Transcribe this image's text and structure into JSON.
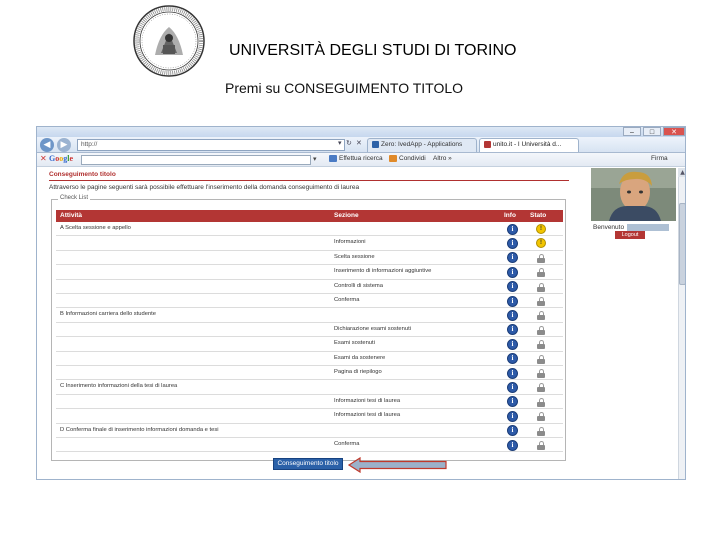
{
  "slide": {
    "title": "UNIVERSITÀ DEGLI STUDI DI TORINO",
    "instruction": "Premi su CONSEGUIMENTO TITOLO"
  },
  "browser": {
    "url": "http://",
    "tabs": [
      {
        "label": "Zero: IvedApp - Applications"
      },
      {
        "label": "unito.it - I Università d..."
      }
    ],
    "window_buttons": [
      "–",
      "□",
      "✕"
    ],
    "toolbar": {
      "search_engine": "Google",
      "buttons": [
        "Effettua ricerca",
        "Condividi",
        "Altro »"
      ],
      "right_label": "Firma"
    }
  },
  "page": {
    "section_title": "Conseguimento titolo",
    "description": "Attraverso le pagine seguenti sarà possibile effettuare l'inserimento della domanda conseguimento di laurea",
    "legend": "Check List",
    "table_headers": {
      "activity": "Attività",
      "section": "Sezione",
      "info": "Info",
      "status": "Stato"
    },
    "rows": [
      {
        "activity": "A  Scelta sessione e appello",
        "section": "",
        "status": "warning"
      },
      {
        "activity": "",
        "section": "Informazioni",
        "status": "warning"
      },
      {
        "activity": "",
        "section": "Scelta sessione",
        "status": "locked"
      },
      {
        "activity": "",
        "section": "Inserimento di informazioni aggiuntive",
        "status": "locked"
      },
      {
        "activity": "",
        "section": "Controlli di sistema",
        "status": "locked"
      },
      {
        "activity": "",
        "section": "Conferma",
        "status": "locked"
      },
      {
        "activity": "B  Informazioni carriera dello studente",
        "section": "",
        "status": "locked"
      },
      {
        "activity": "",
        "section": "Dichiarazione esami sostenuti",
        "status": "locked"
      },
      {
        "activity": "",
        "section": "Esami sostenuti",
        "status": "locked"
      },
      {
        "activity": "",
        "section": "Esami da sostenere",
        "status": "locked"
      },
      {
        "activity": "",
        "section": "Pagina di riepilogo",
        "status": "locked"
      },
      {
        "activity": "C  Inserimento informazioni della tesi di laurea",
        "section": "",
        "status": "locked"
      },
      {
        "activity": "",
        "section": "Informazioni tesi di laurea",
        "status": "locked"
      },
      {
        "activity": "",
        "section": "Informazioni tesi di laurea",
        "status": "locked"
      },
      {
        "activity": "D  Conferma finale di inserimento informazioni domanda e tesi",
        "section": "",
        "status": "locked"
      },
      {
        "activity": "",
        "section": "Conferma",
        "status": "locked"
      }
    ],
    "info_icon_label": "i",
    "submit_button": "Conseguimento titolo",
    "welcome_label": "Benvenuto",
    "logout_button": "Logout"
  }
}
